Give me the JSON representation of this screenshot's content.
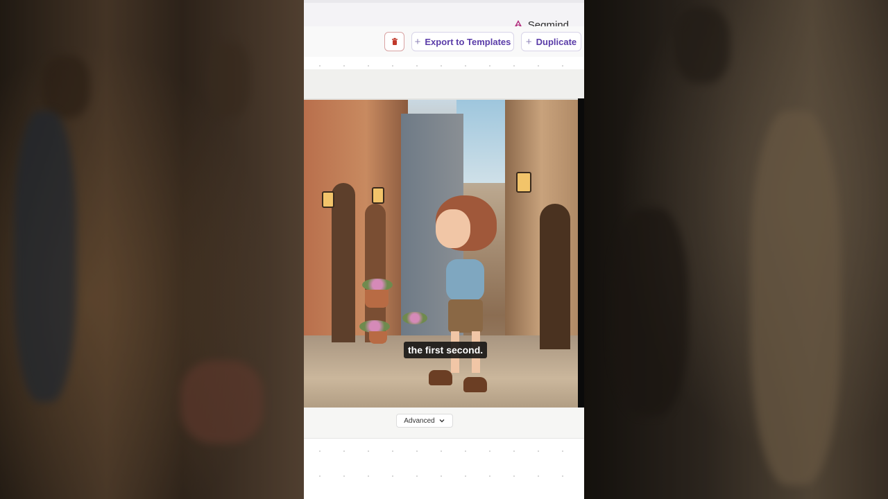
{
  "header": {
    "brand_name": "Segmind"
  },
  "toolbar": {
    "delete_icon": "trash-icon",
    "export_label": "Export to Templates",
    "duplicate_label": "Duplicate",
    "plus_glyph": "+"
  },
  "video": {
    "caption": "the first second."
  },
  "advanced": {
    "label": "Advanced",
    "icon": "chevron-down-icon"
  },
  "colors": {
    "accent": "#5a3ca8",
    "delete": "#c0392b"
  }
}
